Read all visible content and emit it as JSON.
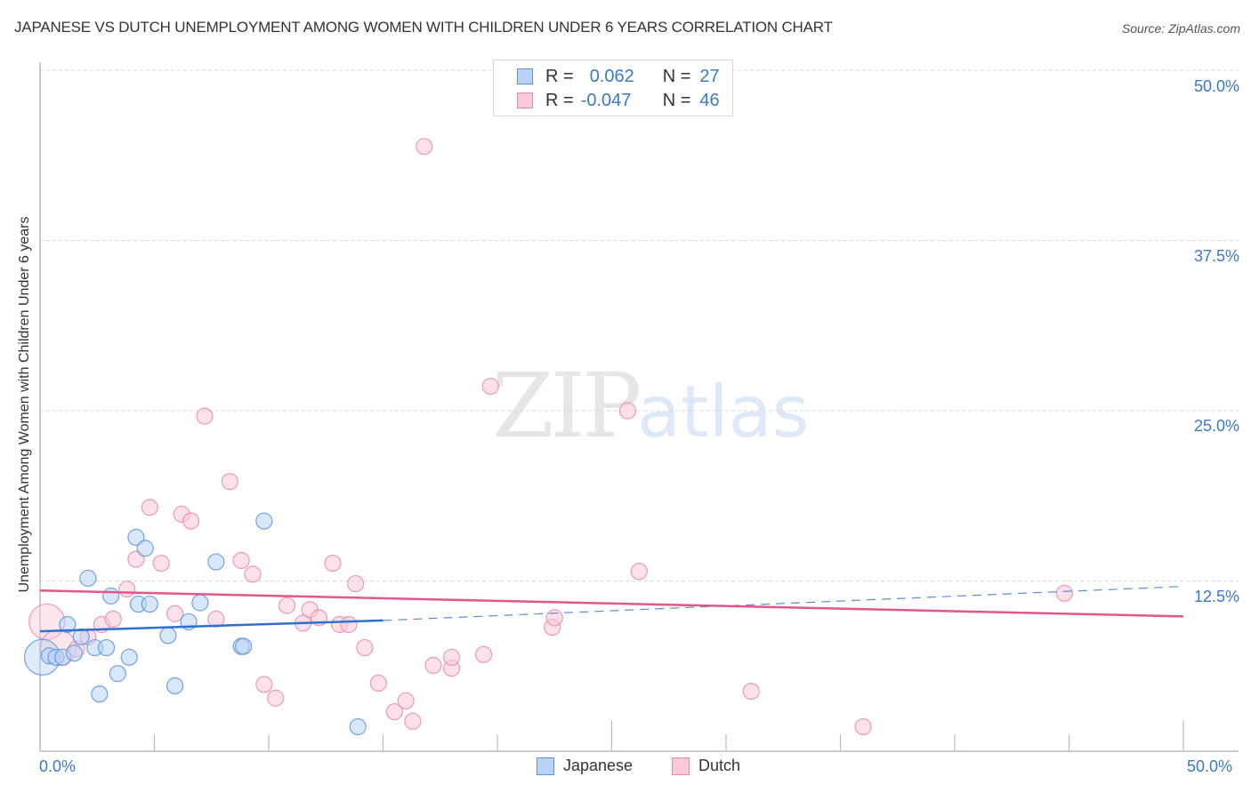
{
  "title": "JAPANESE VS DUTCH UNEMPLOYMENT AMONG WOMEN WITH CHILDREN UNDER 6 YEARS CORRELATION CHART",
  "source": "Source: ZipAtlas.com",
  "watermark": {
    "zip": "ZIP",
    "atlas": "atlas"
  },
  "colors": {
    "japanese_fill": "#b8d3f5",
    "japanese_stroke": "#5b94da",
    "japanese_line": "#2f6fd0",
    "dutch_fill": "#f9c9d8",
    "dutch_stroke": "#e88aa9",
    "dutch_line": "#e2578a",
    "axis_label": "#3a78c9",
    "grid": "#d9d9d9"
  },
  "stats_legend": [
    {
      "series": "Japanese",
      "r_label": "R =",
      "r_value": "0.062",
      "n_label": "N =",
      "n_value": "27"
    },
    {
      "series": "Dutch",
      "r_label": "R =",
      "r_value": "-0.047",
      "n_label": "N =",
      "n_value": "46"
    }
  ],
  "bottom_legend": [
    "Japanese",
    "Dutch"
  ],
  "chart_data": {
    "type": "scatter",
    "title": "JAPANESE VS DUTCH UNEMPLOYMENT AMONG WOMEN WITH CHILDREN UNDER 6 YEARS CORRELATION CHART",
    "xlabel": "",
    "ylabel": "Unemployment Among Women with Children Under 6 years",
    "xlim": [
      0,
      50
    ],
    "ylim": [
      0,
      50
    ],
    "x_tick_labels": [
      "0.0%",
      "50.0%"
    ],
    "y_tick_labels": [
      "12.5%",
      "25.0%",
      "37.5%",
      "50.0%"
    ],
    "y_ticks": [
      12.5,
      25.0,
      37.5,
      50.0
    ],
    "x_minor_ticks": [
      5,
      10,
      15,
      20,
      25,
      30,
      35,
      40,
      45,
      50
    ],
    "grid": true,
    "legend_position": "top-center",
    "series": [
      {
        "name": "Japanese",
        "r": 0.062,
        "n": 27,
        "points": [
          [
            0.1,
            6.9,
            "large"
          ],
          [
            0.4,
            7.0
          ],
          [
            0.7,
            6.9
          ],
          [
            1.0,
            6.9
          ],
          [
            1.2,
            9.3
          ],
          [
            1.8,
            8.4
          ],
          [
            2.1,
            12.7
          ],
          [
            2.4,
            7.6
          ],
          [
            2.6,
            4.2
          ],
          [
            2.9,
            7.6
          ],
          [
            3.1,
            11.4
          ],
          [
            3.4,
            5.7
          ],
          [
            3.9,
            6.9
          ],
          [
            4.2,
            15.7
          ],
          [
            4.3,
            10.8
          ],
          [
            4.6,
            14.9
          ],
          [
            4.8,
            10.8
          ],
          [
            5.6,
            8.5
          ],
          [
            5.9,
            4.8
          ],
          [
            6.5,
            9.5
          ],
          [
            7.0,
            10.9
          ],
          [
            7.7,
            13.9
          ],
          [
            8.8,
            7.7
          ],
          [
            8.9,
            7.7
          ],
          [
            9.8,
            16.9
          ],
          [
            13.9,
            1.8
          ],
          [
            1.5,
            7.2
          ]
        ],
        "trend": {
          "x0": 0,
          "y0": 8.8,
          "x1": 15,
          "y1": 9.6,
          "dashed_to_x": 50,
          "dashed_to_y": 12.1
        }
      },
      {
        "name": "Dutch",
        "r": -0.047,
        "n": 46,
        "points": [
          [
            0.3,
            9.5,
            "large"
          ],
          [
            0.8,
            7.6,
            "large"
          ],
          [
            1.6,
            7.5
          ],
          [
            2.1,
            8.4
          ],
          [
            2.7,
            9.3
          ],
          [
            3.2,
            9.7
          ],
          [
            3.8,
            11.9
          ],
          [
            4.2,
            14.1
          ],
          [
            4.8,
            17.9
          ],
          [
            5.3,
            13.8
          ],
          [
            5.9,
            10.1
          ],
          [
            6.2,
            17.4
          ],
          [
            6.6,
            16.9
          ],
          [
            7.2,
            24.6
          ],
          [
            7.7,
            9.7
          ],
          [
            8.3,
            19.8
          ],
          [
            8.8,
            14.0
          ],
          [
            9.3,
            13.0
          ],
          [
            9.8,
            4.9
          ],
          [
            10.3,
            3.9
          ],
          [
            10.8,
            10.7
          ],
          [
            11.5,
            9.4
          ],
          [
            11.8,
            10.4
          ],
          [
            12.2,
            9.8
          ],
          [
            12.8,
            13.8
          ],
          [
            13.1,
            9.3
          ],
          [
            13.5,
            9.3
          ],
          [
            13.8,
            12.3
          ],
          [
            14.2,
            7.6
          ],
          [
            14.8,
            5.0
          ],
          [
            15.5,
            2.9
          ],
          [
            16.0,
            3.7
          ],
          [
            16.3,
            2.2
          ],
          [
            16.8,
            44.4
          ],
          [
            17.2,
            6.3
          ],
          [
            18.0,
            6.1
          ],
          [
            18.0,
            6.9
          ],
          [
            19.4,
            7.1
          ],
          [
            19.7,
            26.8
          ],
          [
            22.4,
            9.1
          ],
          [
            22.5,
            9.8
          ],
          [
            25.7,
            25.0
          ],
          [
            26.2,
            13.2
          ],
          [
            31.1,
            4.4
          ],
          [
            36.0,
            1.8
          ],
          [
            44.8,
            11.6
          ]
        ],
        "trend": {
          "x0": 0,
          "y0": 11.8,
          "x1": 50,
          "y1": 9.9
        }
      }
    ]
  }
}
